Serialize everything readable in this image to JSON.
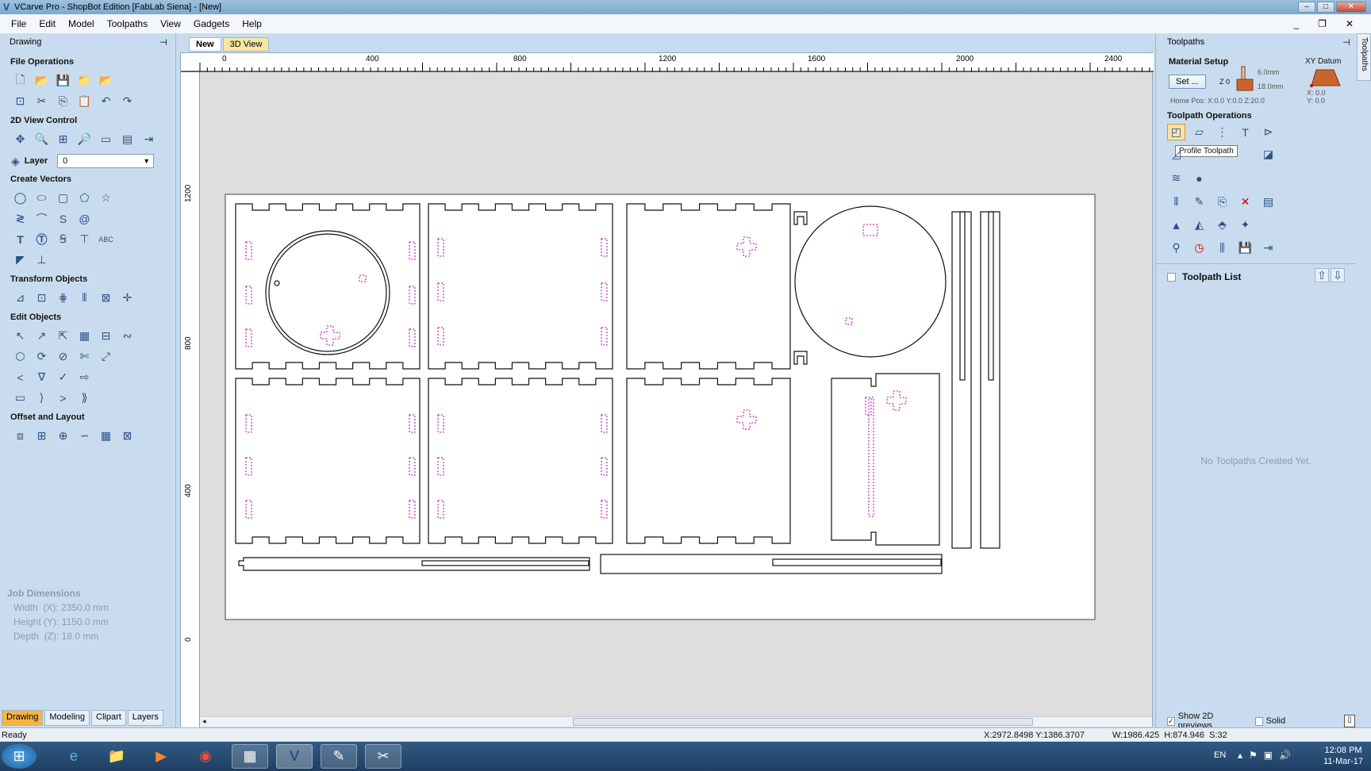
{
  "window": {
    "title": "VCarve Pro - ShopBot Edition [FabLab Siena] - [New]"
  },
  "menu": [
    "File",
    "Edit",
    "Model",
    "Toolpaths",
    "View",
    "Gadgets",
    "Help"
  ],
  "left_panel": {
    "header": "Drawing",
    "sections": {
      "file_ops": "File Operations",
      "view_control": "2D View Control",
      "layer_label": "Layer",
      "layer_value": "0",
      "create_vectors": "Create Vectors",
      "transform": "Transform Objects",
      "edit": "Edit Objects",
      "offset": "Offset and Layout"
    },
    "job_dims": {
      "title": "Job Dimensions",
      "width": "Width  (X): 2350.0 mm",
      "height": "Height (Y): 1150.0 mm",
      "depth": "Depth  (Z): 18.0 mm"
    },
    "tabs": [
      "Drawing",
      "Modeling",
      "Clipart",
      "Layers"
    ]
  },
  "doc_tabs": [
    "New",
    "3D View"
  ],
  "ruler": {
    "top": [
      "0",
      "400",
      "800",
      "1200",
      "1600",
      "2000",
      "2400"
    ],
    "left": [
      "1200",
      "800",
      "400",
      "0"
    ]
  },
  "right_panel": {
    "header": "Toolpaths",
    "side_tab": "Toolpaths",
    "material_setup": "Material Setup",
    "set_button": "Set ...",
    "z_label": "Z 0",
    "thickness_top": "6.0mm",
    "thickness": "18.0mm",
    "xy_datum": "XY Datum",
    "datum_x": "X: 0.0",
    "datum_y": "Y: 0.0",
    "home_pos": "Home Pos:  X:0.0 Y:0.0 Z:20.0",
    "toolpath_ops": "Toolpath Operations",
    "tooltip": "Profile Toolpath",
    "toolpath_list": "Toolpath List",
    "empty_msg": "No Toolpaths Created Yet.",
    "show_previews": "Show 2D previews",
    "solid": "Solid"
  },
  "status": {
    "ready": "Ready",
    "coords": "X:2972.8498 Y:1386.3707",
    "size": "W:1986.425  H:874.946  S:32"
  },
  "taskbar": {
    "lang": "EN",
    "time": "12:08 PM",
    "date": "11-Mar-17"
  },
  "colors": {
    "accent": "#f5b542",
    "panel": "#c9dcef",
    "dashed": "#b400b4"
  }
}
